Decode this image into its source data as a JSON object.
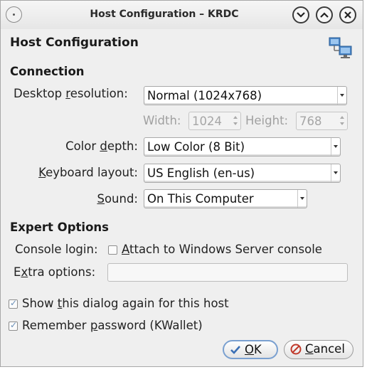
{
  "window": {
    "title": "Host Configuration – KRDC"
  },
  "header": {
    "title": "Host Configuration",
    "icon": "network-computers-icon"
  },
  "connection": {
    "section_label": "Connection",
    "resolution": {
      "label_pre": "Desktop ",
      "label_key": "r",
      "label_post": "esolution:",
      "value": "Normal (1024x768)",
      "width_label": "Width:",
      "width_value": "1024",
      "height_label": "Height:",
      "height_value": "768"
    },
    "color_depth": {
      "label_pre": "Color ",
      "label_key": "d",
      "label_post": "epth:",
      "value": "Low Color (8 Bit)"
    },
    "keyboard_layout": {
      "label_pre": "",
      "label_key": "K",
      "label_post": "eyboard layout:",
      "value": "US English (en-us)"
    },
    "sound": {
      "label_pre": "",
      "label_key": "S",
      "label_post": "ound:",
      "value": "On This Computer"
    }
  },
  "expert": {
    "section_label": "Expert Options",
    "console_login": {
      "label": "Console login:",
      "checkbox_key": "A",
      "checkbox_label": "ttach to Windows Server console",
      "checked": false
    },
    "extra_options": {
      "label_pre": "E",
      "label_key": "x",
      "label_post": "tra options:",
      "value": ""
    }
  },
  "options": {
    "show_dialog": {
      "pre": "Show ",
      "key": "t",
      "post": "his dialog again for this host",
      "checked": true
    },
    "remember_password": {
      "pre": "Remember ",
      "key": "p",
      "post": "assword (KWallet)",
      "checked": true
    }
  },
  "buttons": {
    "ok_key": "O",
    "ok_rest": "K",
    "cancel_key": "C",
    "cancel_rest": "ancel"
  },
  "colors": {
    "background": "#efefef",
    "accent": "#7aa0d0",
    "ok_icon": "#3a6fb5",
    "cancel_icon": "#c0392b"
  }
}
